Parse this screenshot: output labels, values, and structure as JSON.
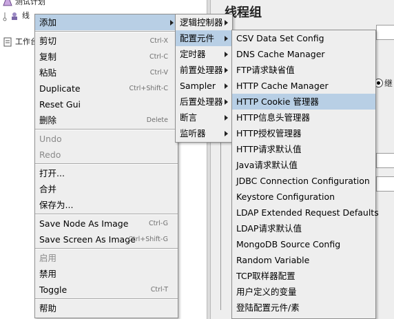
{
  "tree": {
    "items": [
      {
        "label": "测试计划"
      },
      {
        "label": "线"
      },
      {
        "label": "工作台"
      }
    ]
  },
  "right_panel": {
    "title": "线程组",
    "radio_label": "继"
  },
  "main_menu": {
    "items": [
      {
        "label": "添加",
        "accel": "",
        "submenu": true,
        "selected": true,
        "disabled": false
      },
      {
        "label": "剪切",
        "accel": "Ctrl-X",
        "disabled": false
      },
      {
        "label": "复制",
        "accel": "Ctrl-C",
        "disabled": false
      },
      {
        "label": "粘贴",
        "accel": "Ctrl-V",
        "disabled": false
      },
      {
        "label": "Duplicate",
        "accel": "Ctrl+Shift-C",
        "disabled": false
      },
      {
        "label": "Reset Gui",
        "accel": "",
        "disabled": false
      },
      {
        "label": "删除",
        "accel": "Delete",
        "disabled": false
      },
      {
        "label": "Undo",
        "accel": "",
        "disabled": true
      },
      {
        "label": "Redo",
        "accel": "",
        "disabled": true
      },
      {
        "label": "打开...",
        "accel": "",
        "disabled": false
      },
      {
        "label": "合并",
        "accel": "",
        "disabled": false
      },
      {
        "label": "保存为...",
        "accel": "",
        "disabled": false
      },
      {
        "label": "Save Node As Image",
        "accel": "Ctrl-G",
        "disabled": false
      },
      {
        "label": "Save Screen As Image",
        "accel": "Ctrl+Shift-G",
        "disabled": false
      },
      {
        "label": "启用",
        "accel": "",
        "disabled": true
      },
      {
        "label": "禁用",
        "accel": "",
        "disabled": false
      },
      {
        "label": "Toggle",
        "accel": "Ctrl-T",
        "disabled": false
      },
      {
        "label": "帮助",
        "accel": "",
        "disabled": false
      }
    ]
  },
  "add_menu": {
    "items": [
      {
        "label": "逻辑控制器"
      },
      {
        "label": "配置元件"
      },
      {
        "label": "定时器"
      },
      {
        "label": "前置处理器"
      },
      {
        "label": "Sampler"
      },
      {
        "label": "后置处理器"
      },
      {
        "label": "断言"
      },
      {
        "label": "监听器"
      }
    ]
  },
  "config_menu": {
    "items": [
      {
        "label": "CSV Data Set Config"
      },
      {
        "label": "DNS Cache Manager"
      },
      {
        "label": "FTP请求缺省值"
      },
      {
        "label": "HTTP Cache Manager"
      },
      {
        "label": "HTTP Cookie 管理器"
      },
      {
        "label": "HTTP信息头管理器"
      },
      {
        "label": "HTTP授权管理器"
      },
      {
        "label": "HTTP请求默认值"
      },
      {
        "label": "Java请求默认值"
      },
      {
        "label": "JDBC Connection Configuration"
      },
      {
        "label": "Keystore Configuration"
      },
      {
        "label": "LDAP Extended Request Defaults"
      },
      {
        "label": "LDAP请求默认值"
      },
      {
        "label": "MongoDB Source Config"
      },
      {
        "label": "Random Variable"
      },
      {
        "label": "TCP取样器配置"
      },
      {
        "label": "用户定义的变量"
      },
      {
        "label": "登陆配置元件/素"
      }
    ]
  },
  "colors": {
    "menu_bg": "#eeeeee",
    "selection": "#b8cfe5",
    "disabled_text": "#8a8a8a",
    "accelerator_text": "#6f6f6f"
  }
}
